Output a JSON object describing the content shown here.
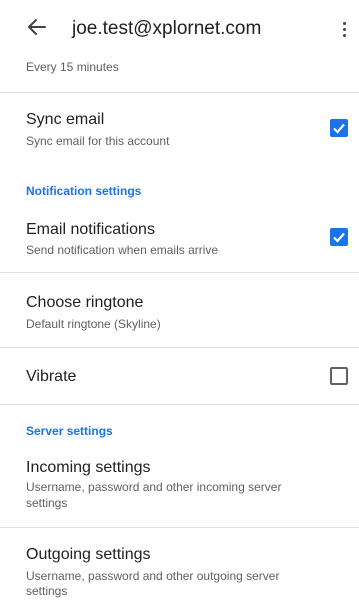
{
  "header": {
    "title": "joe.test@xplornet.com",
    "back_icon": "arrow-back-icon",
    "more_icon": "more-vert-icon"
  },
  "sync_frequency": {
    "value": "Every 15 minutes"
  },
  "sync_email": {
    "title": "Sync email",
    "summary": "Sync email for this account",
    "checked": true
  },
  "notification_settings": {
    "label": "Notification settings"
  },
  "email_notifications": {
    "title": "Email notifications",
    "summary": "Send notification when emails arrive",
    "checked": true
  },
  "choose_ringtone": {
    "title": "Choose ringtone",
    "summary": "Default ringtone (Skyline)"
  },
  "vibrate": {
    "title": "Vibrate",
    "checked": false
  },
  "server_settings": {
    "label": "Server settings"
  },
  "incoming_settings": {
    "title": "Incoming settings",
    "summary_line1": "Username, password and other incoming server",
    "summary_line2": "settings"
  },
  "outgoing_settings": {
    "title": "Outgoing settings",
    "summary_line1": "Username, password and other outgoing server",
    "summary_line2": "settings"
  },
  "colors": {
    "accent": "#1a73e8",
    "text_primary": "#212121",
    "text_secondary": "#616161",
    "divider": "#e0e0e0"
  }
}
